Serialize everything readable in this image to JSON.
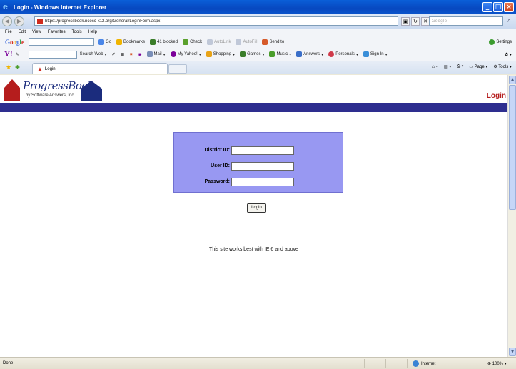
{
  "window": {
    "title": "Login - Windows Internet Explorer",
    "minimize": "_",
    "maximize": "□",
    "close": "×"
  },
  "address": {
    "url": "https://progressbook.ncocc-k12.org/General/LoginForm.aspx",
    "search_placeholder": "Google"
  },
  "menu": [
    "File",
    "Edit",
    "View",
    "Favorites",
    "Tools",
    "Help"
  ],
  "google_toolbar": {
    "logo": [
      "G",
      "o",
      "o",
      "g",
      "l",
      "e"
    ],
    "items": [
      "Go",
      "Bookmarks",
      "41 blocked",
      "Check",
      "AutoLink",
      "AutoFill",
      "Send to"
    ],
    "right": "Settings"
  },
  "yahoo_toolbar": {
    "logo": "Y!",
    "items": [
      "Search Web",
      "Mail",
      "My Yahoo!",
      "Shopping",
      "Games",
      "Music",
      "Answers",
      "Personals",
      "Sign In"
    ]
  },
  "tab": {
    "label": "Login"
  },
  "command_bar": [
    "Page",
    "Tools"
  ],
  "page": {
    "brand": "ProgressBook",
    "brand_sub": "by Software Answers, Inc.",
    "heading": "Login",
    "fields": [
      {
        "label": "District ID:",
        "value": ""
      },
      {
        "label": "User ID:",
        "value": ""
      },
      {
        "label": "Password:",
        "value": ""
      }
    ],
    "login_button": "Login",
    "note": "This site works best with IE 6 and above"
  },
  "status": {
    "text": "Done",
    "zone": "Internet",
    "zoom": "100%"
  },
  "colors": {
    "brand_red": "#b51d1d",
    "brand_navy": "#1b2c7d",
    "band": "#2e2e8f",
    "login_box": "#9898f2"
  }
}
